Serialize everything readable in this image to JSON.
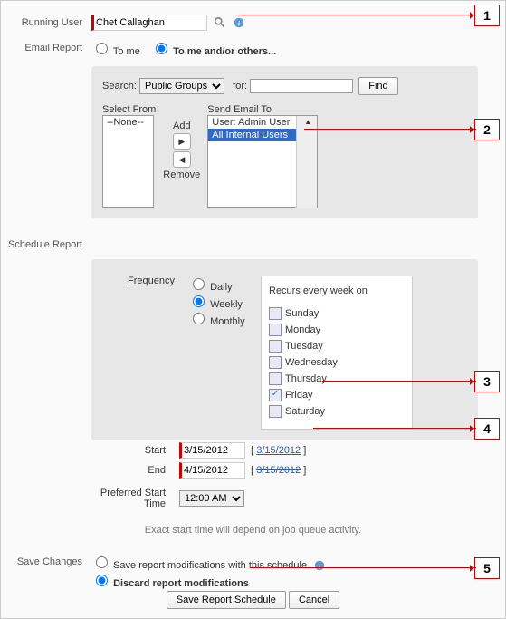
{
  "running": {
    "label": "Running User",
    "value": "Chet Callaghan"
  },
  "email": {
    "label": "Email Report",
    "opt1": "To me",
    "opt2": "To me and/or others..."
  },
  "search": {
    "label": "Search:",
    "scope": "Public Groups",
    "for": "for:",
    "find": "Find",
    "selectFrom": "Select From",
    "sendTo": "Send Email To",
    "add": "Add",
    "remove": "Remove",
    "noneOpt": "--None--",
    "listItems": [
      "User: Admin User",
      "All Internal Users"
    ]
  },
  "sched": {
    "label": "Schedule Report",
    "freq": "Frequency",
    "daily": "Daily",
    "weekly": "Weekly",
    "monthly": "Monthly",
    "recur": "Recurs every week on",
    "days": [
      "Sunday",
      "Monday",
      "Tuesday",
      "Wednesday",
      "Thursday",
      "Friday",
      "Saturday"
    ],
    "checkedDay": "Friday",
    "start": "Start",
    "startVal": "3/15/2012",
    "startLink": "3/15/2012",
    "end": "End",
    "endVal": "4/15/2012",
    "endLink": "3/15/2012",
    "pst": "Preferred Start Time",
    "pstVal": "12:00 AM",
    "note": "Exact start time will depend on job queue activity."
  },
  "save": {
    "label": "Save Changes",
    "opt1": "Save report modifications with this schedule",
    "opt2": "Discard report modifications"
  },
  "btns": {
    "save": "Save Report Schedule",
    "cancel": "Cancel"
  },
  "callouts": [
    "1",
    "2",
    "3",
    "4",
    "5"
  ]
}
